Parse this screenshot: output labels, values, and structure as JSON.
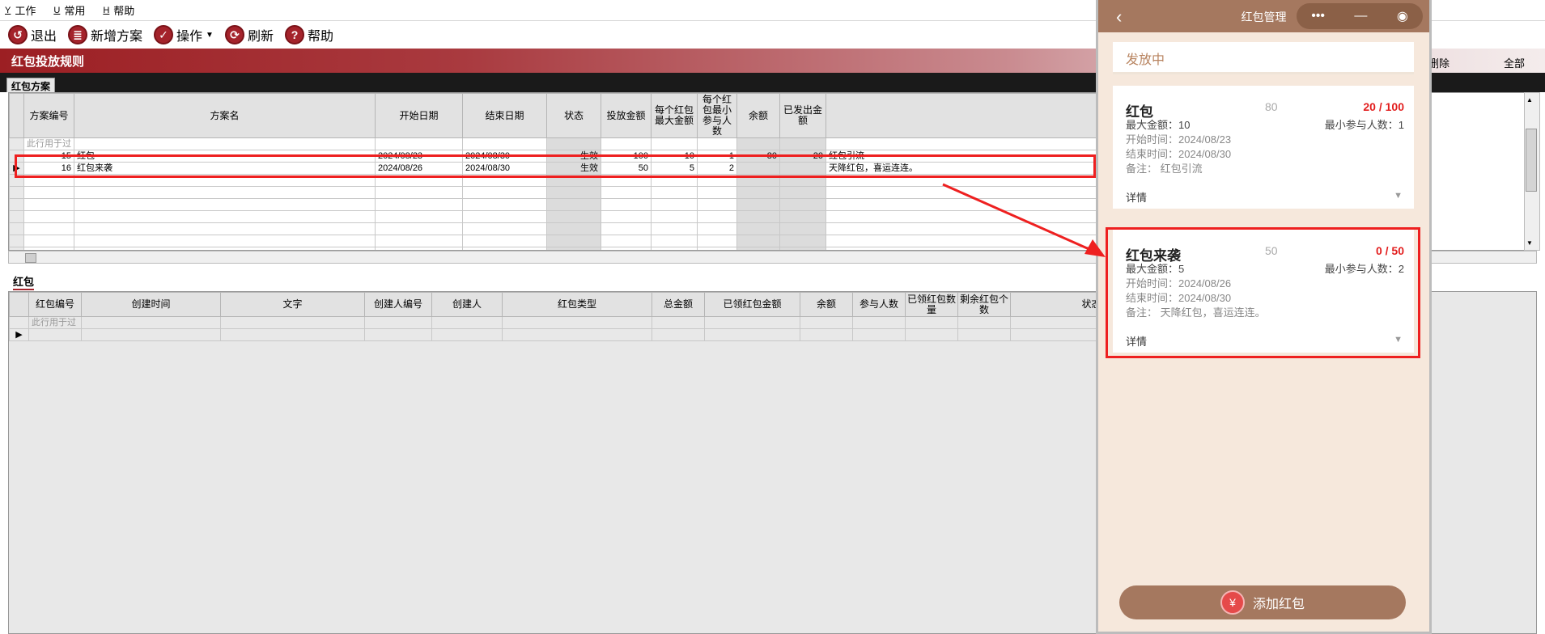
{
  "menu": [
    {
      "accel": "Y",
      "label": "工作"
    },
    {
      "accel": "U",
      "label": "常用"
    },
    {
      "accel": "H",
      "label": "帮助"
    }
  ],
  "toolbar": {
    "exit": "退出",
    "add_plan": "新增方案",
    "operate": "操作",
    "refresh": "刷新",
    "help": "帮助"
  },
  "window_title": "红包投放规则",
  "title_right": {
    "delete": "删除",
    "all": "全部"
  },
  "plan_tab": "红包方案",
  "plan_grid": {
    "headers": [
      "方案编号",
      "方案名",
      "开始日期",
      "结束日期",
      "状态",
      "投放金额",
      "每个红包最大金额",
      "每个红包最小参与人数",
      "余额",
      "已发出金额",
      ""
    ],
    "filter_hint": "此行用于过",
    "rows": [
      {
        "id": "15",
        "name": "红包",
        "start": "2024/08/23",
        "end": "2024/08/30",
        "status": "生效",
        "amount": "100",
        "max_each": "10",
        "min_people": "1",
        "balance": "80",
        "sent": "20",
        "note": "红包引流"
      },
      {
        "id": "16",
        "name": "红包来袭",
        "start": "2024/08/26",
        "end": "2024/08/30",
        "status": "生效",
        "amount": "50",
        "max_each": "5",
        "min_people": "2",
        "balance": "",
        "sent": "",
        "note": "天降红包，喜运连连。"
      }
    ]
  },
  "redpack_tab": "红包",
  "redpack_grid": {
    "headers": [
      "红包编号",
      "创建时间",
      "文字",
      "创建人编号",
      "创建人",
      "红包类型",
      "总金额",
      "已领红包金额",
      "余额",
      "参与人数",
      "已领红包数量",
      "剩余红包个数",
      "状态"
    ],
    "filter_hint": "此行用于过"
  },
  "phone": {
    "nav_title": "红包管理",
    "filter_label": "发放中",
    "cards": [
      {
        "name": "红包",
        "total": "80",
        "count": "20 / 100",
        "max_label": "最大金额：",
        "max_value": "10",
        "min_label": "最小参与人数：",
        "min_value": "1",
        "start_label": "开始时间：",
        "start_value": "2024/08/23",
        "end_label": "结束时间：",
        "end_value": "2024/08/30",
        "note_label": "备注：",
        "note_value": "红包引流",
        "detail": "详情"
      },
      {
        "name": "红包来袭",
        "total": "50",
        "count": "0 / 50",
        "max_label": "最大金额：",
        "max_value": "5",
        "min_label": "最小参与人数：",
        "min_value": "2",
        "start_label": "开始时间：",
        "start_value": "2024/08/26",
        "end_label": "结束时间：",
        "end_value": "2024/08/30",
        "note_label": "备注：",
        "note_value": "天降红包，喜运连连。",
        "detail": "详情"
      }
    ],
    "add_button": "添加红包",
    "add_icon_glyph": "¥"
  },
  "colors": {
    "brand": "#a4232b",
    "highlight": "#ee2020",
    "phone_accent": "#a5785f",
    "count_red": "#e21d1d"
  }
}
